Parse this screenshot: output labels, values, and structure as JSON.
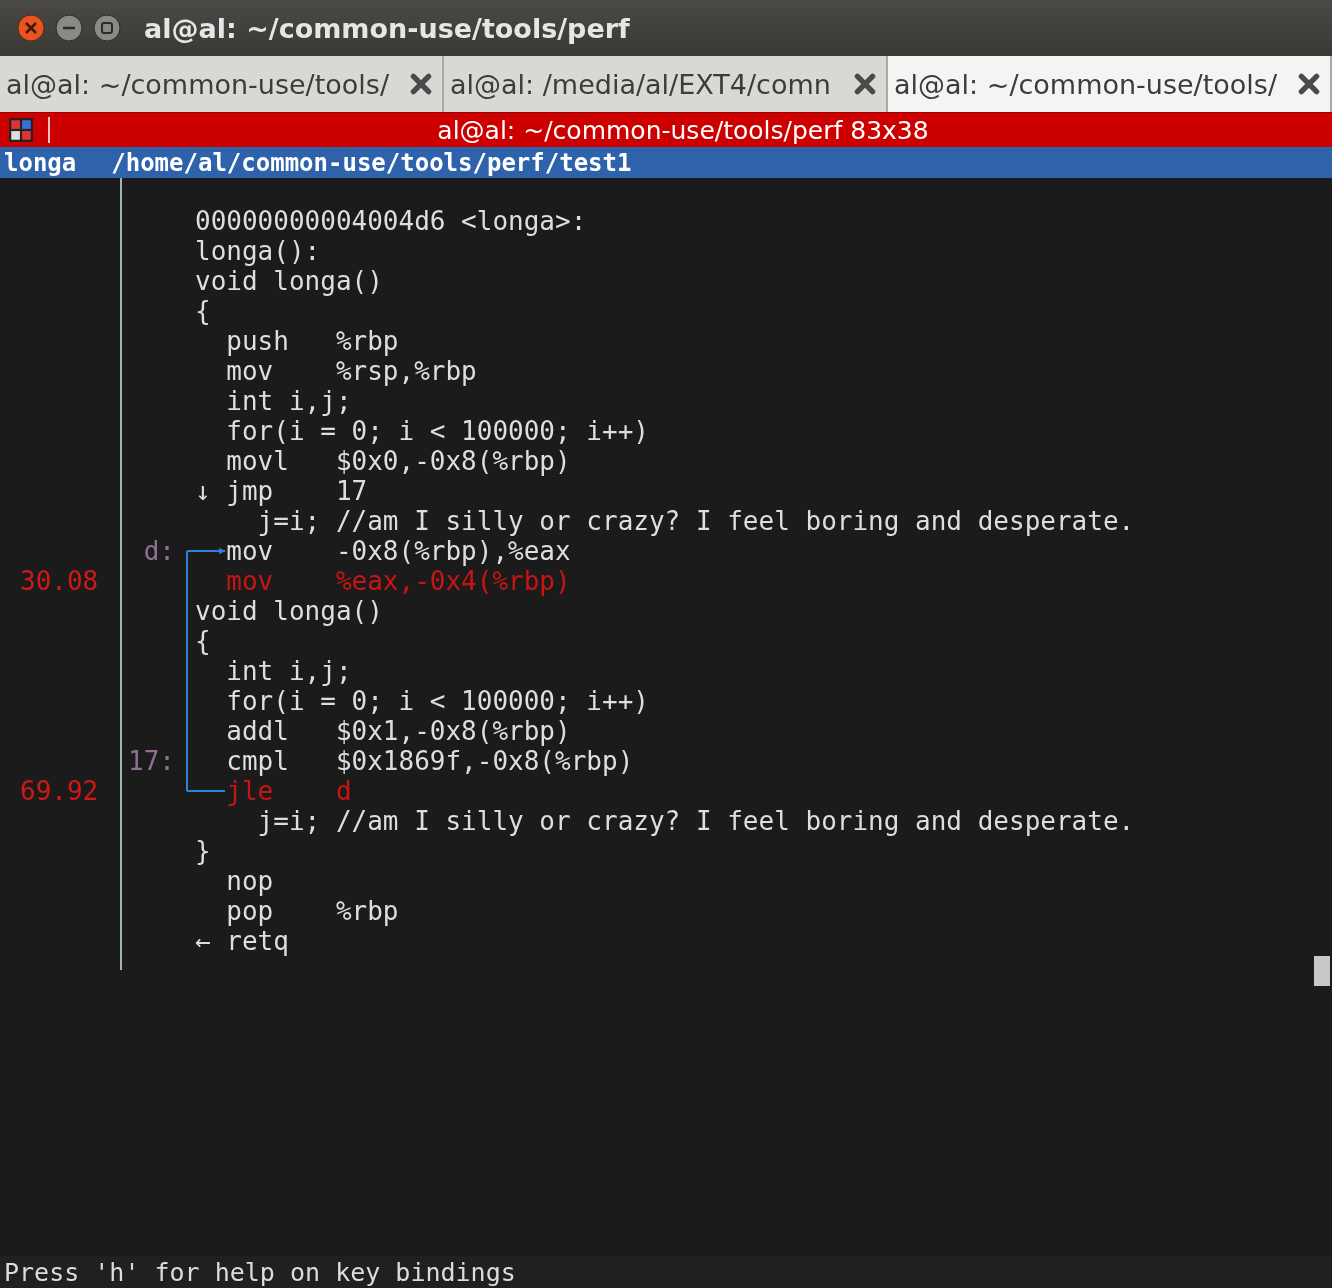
{
  "window": {
    "title": "al@al: ~/common-use/tools/perf"
  },
  "tabs": [
    {
      "label": "al@al: ~/common-use/tools/",
      "selected": false
    },
    {
      "label": "al@al: /media/al/EXT4/comn",
      "selected": false
    },
    {
      "label": "al@al: ~/common-use/tools/",
      "selected": true
    }
  ],
  "terminal_title": "al@al: ~/common-use/tools/perf 83x38",
  "header": {
    "symbol": "longa",
    "path": "/home/al/common-use/tools/perf/test1"
  },
  "lines": [
    {
      "kind": "source",
      "jump_target": false,
      "jump_source": false,
      "code": "00000000004004d6 <longa>:"
    },
    {
      "kind": "source",
      "jump_target": false,
      "jump_source": false,
      "code": "longa():"
    },
    {
      "kind": "source",
      "jump_target": false,
      "jump_source": false,
      "code": "void longa()"
    },
    {
      "kind": "source",
      "jump_target": false,
      "jump_source": false,
      "code": "{"
    },
    {
      "kind": "asm",
      "jump_target": false,
      "jump_source": false,
      "code": "  push   %rbp"
    },
    {
      "kind": "asm",
      "jump_target": false,
      "jump_source": false,
      "code": "  mov    %rsp,%rbp"
    },
    {
      "kind": "source",
      "jump_target": false,
      "jump_source": false,
      "code": "  int i,j;"
    },
    {
      "kind": "source",
      "jump_target": false,
      "jump_source": false,
      "code": "  for(i = 0; i < 100000; i++)"
    },
    {
      "kind": "asm",
      "jump_target": false,
      "jump_source": false,
      "code": "  movl   $0x0,-0x8(%rbp)"
    },
    {
      "kind": "asm",
      "jump_target": false,
      "jump_source": false,
      "code": "↓ jmp    17"
    },
    {
      "kind": "source",
      "jump_target": false,
      "jump_source": false,
      "code": "    j=i; //am I silly or crazy? I feel boring and desperate."
    },
    {
      "kind": "asm",
      "label": "d:",
      "jump_target": true,
      "jump_source": false,
      "code": "  mov    -0x8(%rbp),%eax"
    },
    {
      "kind": "hot",
      "percent": "30.08",
      "jump_target": false,
      "jump_source": false,
      "code": "  mov    %eax,-0x4(%rbp)"
    },
    {
      "kind": "source",
      "jump_target": false,
      "jump_source": false,
      "code": "void longa()"
    },
    {
      "kind": "source",
      "jump_target": false,
      "jump_source": false,
      "code": "{"
    },
    {
      "kind": "source",
      "jump_target": false,
      "jump_source": false,
      "code": "  int i,j;"
    },
    {
      "kind": "source",
      "jump_target": false,
      "jump_source": false,
      "code": "  for(i = 0; i < 100000; i++)"
    },
    {
      "kind": "asm",
      "jump_target": false,
      "jump_source": false,
      "code": "  addl   $0x1,-0x8(%rbp)"
    },
    {
      "kind": "asm",
      "label": "17:",
      "jump_target": false,
      "jump_source": false,
      "code": "  cmpl   $0x1869f,-0x8(%rbp)"
    },
    {
      "kind": "hot",
      "percent": "69.92",
      "jump_target": false,
      "jump_source": true,
      "code": "  jle    d"
    },
    {
      "kind": "source",
      "jump_target": false,
      "jump_source": false,
      "code": "    j=i; //am I silly or crazy? I feel boring and desperate."
    },
    {
      "kind": "source",
      "jump_target": false,
      "jump_source": false,
      "code": "}"
    },
    {
      "kind": "asm",
      "jump_target": false,
      "jump_source": false,
      "code": "  nop"
    },
    {
      "kind": "asm",
      "jump_target": false,
      "jump_source": false,
      "code": "  pop    %rbp"
    },
    {
      "kind": "asm",
      "jump_target": false,
      "jump_source": false,
      "code": "← retq"
    }
  ],
  "status_bar": "Press 'h' for help on key bindings"
}
